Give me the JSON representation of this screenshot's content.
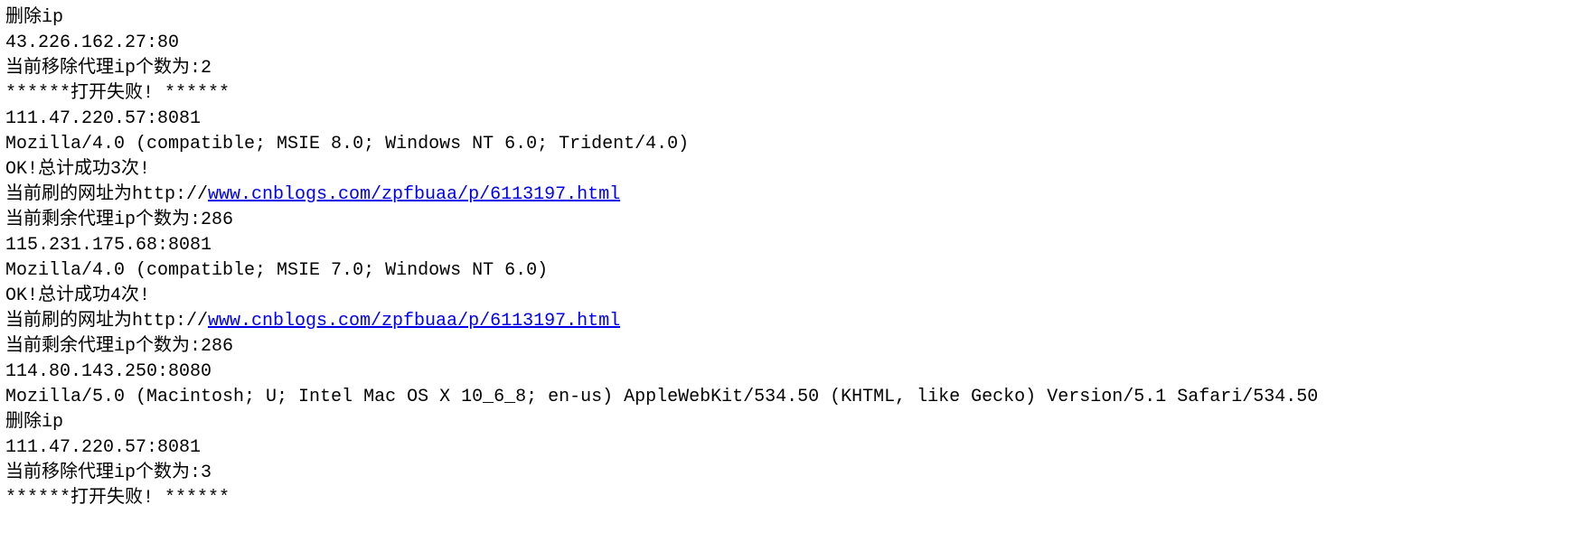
{
  "lines": {
    "l0": "删除ip",
    "l1": "43.226.162.27:80",
    "l2": "当前移除代理ip个数为:2",
    "l3": "******打开失败! ******",
    "l4": "111.47.220.57:8081",
    "l5": "Mozilla/4.0 (compatible; MSIE 8.0; Windows NT 6.0; Trident/4.0)",
    "l6": "OK!总计成功3次!",
    "l7_prefix": "当前刷的网址为http://",
    "l7_link": "www.cnblogs.com/zpfbuaa/p/6113197.html",
    "l8": "当前剩余代理ip个数为:286",
    "l9": "115.231.175.68:8081",
    "l10": "Mozilla/4.0 (compatible; MSIE 7.0; Windows NT 6.0)",
    "l11": "OK!总计成功4次!",
    "l12_prefix": "当前刷的网址为http://",
    "l12_link": "www.cnblogs.com/zpfbuaa/p/6113197.html",
    "l13": "当前剩余代理ip个数为:286",
    "l14": "114.80.143.250:8080",
    "l15": "Mozilla/5.0 (Macintosh; U; Intel Mac OS X 10_6_8; en-us) AppleWebKit/534.50 (KHTML, like Gecko) Version/5.1 Safari/534.50",
    "l16": "删除ip",
    "l17": "111.47.220.57:8081",
    "l18": "当前移除代理ip个数为:3",
    "l19": "******打开失败! ******"
  }
}
